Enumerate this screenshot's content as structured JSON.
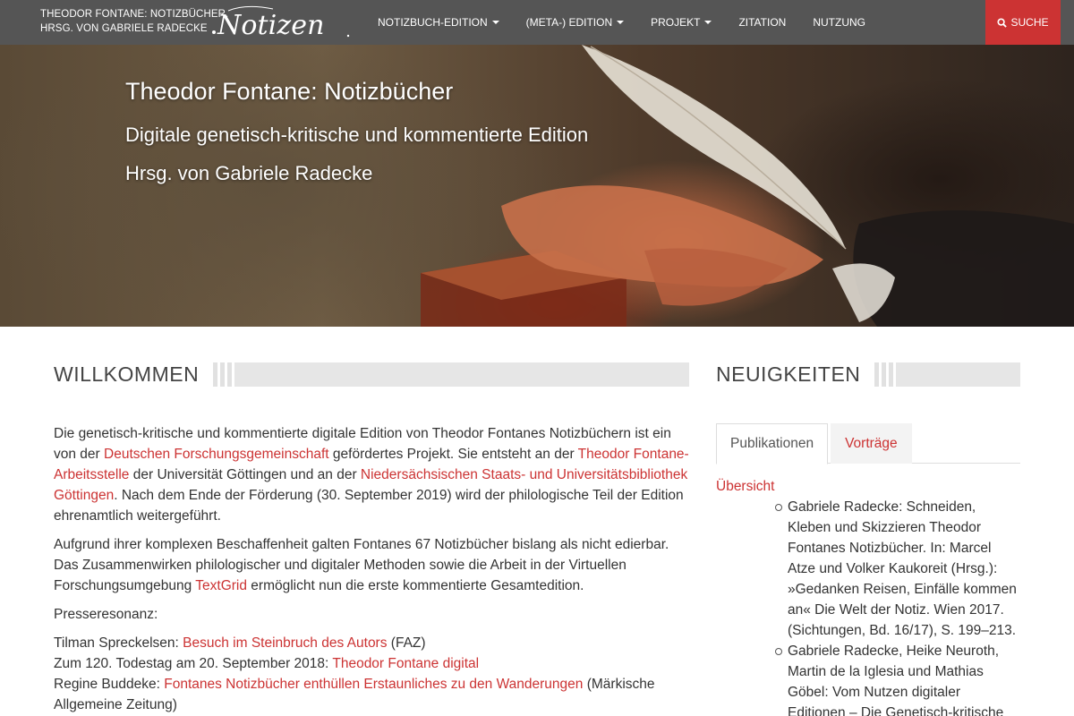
{
  "navbar": {
    "brand_line1": "THEODOR FONTANE: NOTIZBÜCHER.",
    "brand_line2": "HRSG. VON GABRIELE RADECKE",
    "logo_text": "Notizen",
    "items": [
      {
        "label": "NOTIZBUCH-EDITION",
        "dropdown": true
      },
      {
        "label": "(META-) EDITION",
        "dropdown": true
      },
      {
        "label": "PROJEKT",
        "dropdown": true
      },
      {
        "label": "ZITATION",
        "dropdown": false
      },
      {
        "label": "NUTZUNG",
        "dropdown": false
      }
    ],
    "search_label": "SUCHE",
    "search_icon": "search-icon",
    "search_color": "#cc3333"
  },
  "hero": {
    "title": "Theodor Fontane: Notizbücher",
    "subtitle": "Digitale genetisch-kritische und kommentierte Edition",
    "editor": "Hrsg. von Gabriele Radecke"
  },
  "welcome": {
    "heading": "WILLKOMMEN",
    "p1": {
      "t1": "Die genetisch-kritische und kommentierte digitale Edition von Theodor Fontanes Notizbüchern ist ein von der ",
      "l1": "Deutschen Forschungsgemeinschaft",
      "t2": " gefördertes Projekt. Sie entsteht an der ",
      "l2": "Theodor Fontane-Arbeitsstelle",
      "t3": " der Universität Göttingen und an der ",
      "l3": "Niedersächsischen Staats- und Universitätsbibliothek Göttingen",
      "t4": ". Nach dem Ende der Förderung (30. September 2019) wird der philologische Teil der Edition ehrenamtlich weitergeführt."
    },
    "p2": {
      "t1": "Aufgrund ihrer komplexen Beschaffenheit galten Fontanes 67 Notizbücher bislang als nicht edierbar. Das Zusammenwirken philologischer und digitaler Methoden sowie die Arbeit in der Virtuellen Forschungsumgebung ",
      "l1": "TextGrid",
      "t2": " ermöglicht nun die erste kommentierte Gesamtedition."
    },
    "press_label": "Presseresonanz:",
    "press": [
      {
        "pre": "Tilman Spreckelsen: ",
        "link": "Besuch im Steinbruch des Autors",
        "post": " (FAZ)"
      },
      {
        "pre": "Zum 120. Todestag am 20. September 2018: ",
        "link": "Theodor Fontane digital",
        "post": ""
      },
      {
        "pre": "Regine Buddeke: ",
        "link": "Fontanes Notizbücher enthüllen Erstaunliches zu den Wanderungen",
        "post": " (Märkische Allgemeine Zeitung)"
      }
    ]
  },
  "news": {
    "heading": "NEUIGKEITEN",
    "tabs": [
      {
        "label": "Publikationen",
        "active": true
      },
      {
        "label": "Vorträge",
        "active": false
      }
    ],
    "overview_label": "Übersicht",
    "publications": [
      "Gabriele Radecke: Schneiden, Kleben und Skizzieren Theodor Fontanes Notizbücher. In: Marcel Atze und Volker Kaukoreit (Hrsg.): »Gedanken Reisen, Einfälle kommen an« Die Welt der Notiz. Wien 2017. (Sichtungen, Bd. 16/17), S. 199–213.",
      "Gabriele Radecke, Heike Neuroth, Martin de la Iglesia und Mathias Göbel: Vom Nutzen digitaler Editionen – Die Genetisch-kritische"
    ]
  },
  "colors": {
    "accent": "#cc3333",
    "navbar_bg": "#555555"
  }
}
